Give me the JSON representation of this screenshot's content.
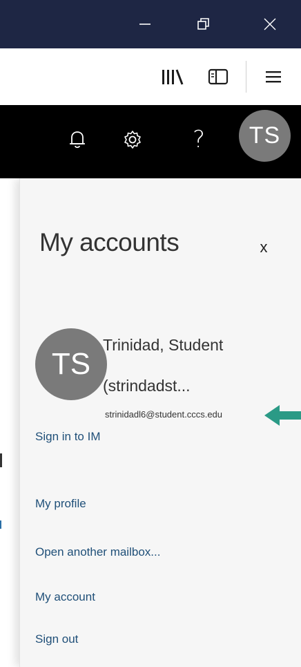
{
  "colors": {
    "titlebar_bg": "#1e2644",
    "header_bg": "#000000",
    "avatar_bg": "#7a7a7a",
    "panel_bg": "#f6f6f6",
    "link_color": "#1f4f78",
    "pointer_arrow": "#2b9a86"
  },
  "window_controls": {
    "icons": [
      "minimize-icon",
      "restore-icon",
      "close-icon"
    ]
  },
  "browser_toolbar": {
    "icons": [
      "library-icon",
      "sidebar-icon",
      "hamburger-menu-icon"
    ]
  },
  "header": {
    "icons": [
      "bell-icon",
      "gear-icon",
      "help-icon"
    ],
    "help_glyph": "?",
    "avatar_initials": "TS"
  },
  "accounts_panel": {
    "title": "My accounts",
    "close_glyph": "x",
    "account": {
      "initials": "TS",
      "name": "Trinidad, Student",
      "alias": "(strindadst...",
      "email": "strinidadl6@student.cccs.edu"
    },
    "links": [
      {
        "label": "Sign in to IM"
      },
      {
        "label": "My profile"
      },
      {
        "label": "Open another mailbox..."
      },
      {
        "label": "My account"
      },
      {
        "label": "Sign out"
      }
    ]
  }
}
